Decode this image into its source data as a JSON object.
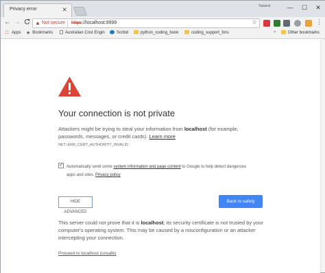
{
  "browser": {
    "tab_title": "Privacy error",
    "tab_close": "✕",
    "profile_name": "Yannick",
    "window_controls": {
      "minimize": "—",
      "maximize": "☐",
      "close": "✕"
    }
  },
  "toolbar": {
    "back": "←",
    "forward": "→",
    "reload": "C",
    "security_label": "Not secure",
    "url_scheme": "https",
    "url_rest": "://localhost:9999",
    "star": "☆",
    "menu": "⋮"
  },
  "bookmarks": {
    "items": [
      {
        "label": "Apps",
        "icon": "apps-icon"
      },
      {
        "label": "Bookmarks",
        "icon": "star-icon"
      },
      {
        "label": "Australian Cost Engin",
        "icon": "document-icon"
      },
      {
        "label": "Scribd",
        "icon": "scribd-icon"
      },
      {
        "label": "python_coding_book",
        "icon": "folder-icon"
      },
      {
        "label": "coding_support_foru",
        "icon": "folder-icon"
      }
    ],
    "overflow": "»",
    "other": "Other bookmarks"
  },
  "page": {
    "heading": "Your connection is not private",
    "desc_before": "Attackers might be trying to steal your information from ",
    "desc_host": "localhost",
    "desc_after": " (for example, passwords, messages, or credit cards). ",
    "learn_more": "Learn more",
    "error_code": "NET::ERR_CERT_AUTHORITY_INVALID",
    "optin_before": "Automatically send some ",
    "optin_link": "system information and page content",
    "optin_middle": " to Google to help detect dangerous apps and sites. ",
    "privacy_link": "Privacy policy",
    "hide_advanced": "HIDE ADVANCED",
    "back_to_safety": "Back to safety",
    "adv_before": "This server could not prove that it is ",
    "adv_host": "localhost",
    "adv_after": "; its security certificate is not trusted by your computer's operating system. This may be caused by a misconfiguration or an attacker intercepting your connection.",
    "proceed": "Proceed to localhost (unsafe)"
  },
  "colors": {
    "danger": "#db4437",
    "primary_button": "#4285f4",
    "not_secure": "#c53929"
  }
}
